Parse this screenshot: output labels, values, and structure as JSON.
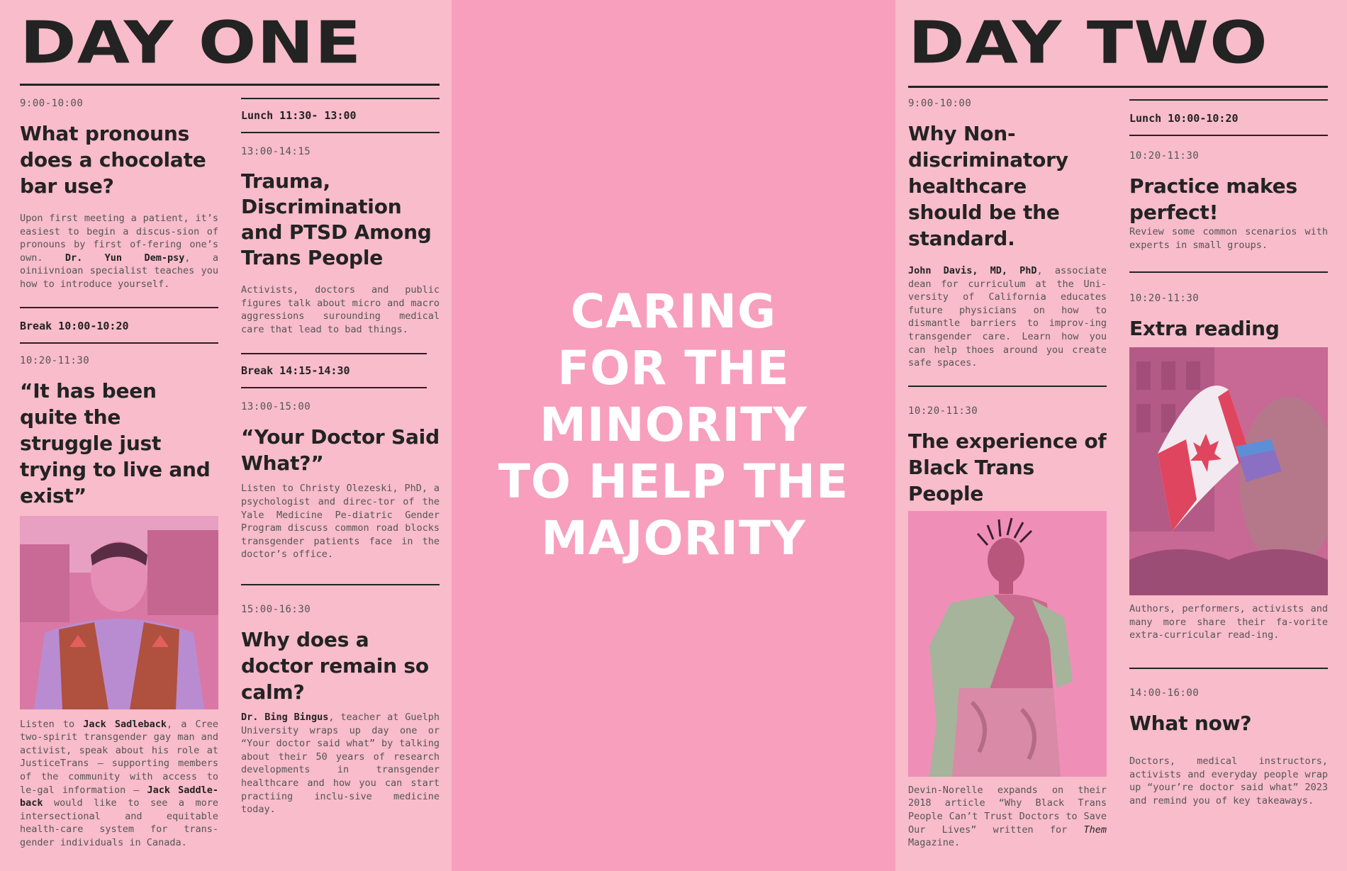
{
  "day_one": {
    "title": "Day One",
    "s1_time": "9:00-10:00",
    "s1_title": "What pronouns does a chocolate bar use?",
    "s1_desc_a": "Upon first meeting a patient, it’s easiest to begin a discus-sion of pronouns by first of-fering one’s own. ",
    "s1_speaker": "Dr. Yun Dem-psy",
    "s1_desc_b": ", a oiniivnioan specialist teaches you how to introduce yourself.",
    "break1": "Break 10:00-10:20",
    "s2_time": "10:20-11:30",
    "s2_title": "“It has been quite the struggle just trying to live and exist”",
    "s2_desc_a": "Listen to ",
    "s2_speaker": "Jack Sadleback",
    "s2_desc_b": ", a Cree two-spirit transgender gay man and activist, speak about his role at JusticeTrans – supporting members of the community with access to le-gal information – ",
    "s2_speaker2": "Jack Saddle-back",
    "s2_desc_c": " would like to see a more intersectional and equitable health-care system for trans-gender individuals in Canada.",
    "lunch": "Lunch 11:30- 13:00",
    "s3_time": "13:00-14:15",
    "s3_title": "Trauma, Discrimination and PTSD Among Trans People",
    "s3_desc": "Activists, doctors and public figures talk about micro and macro aggressions surounding medical care that lead to bad things.",
    "break2": "Break 14:15-14:30",
    "s4_time": "13:00-15:00",
    "s4_title": "“Your Doctor Said What?”",
    "s4_desc": "Listen to Christy Olezeski, PhD, a psychologist and direc-tor of the Yale Medicine Pe-diatric Gender Program discuss common road blocks transgender patients face in the doctor’s office.",
    "s5_time": "15:00-16:30",
    "s5_title": "Why does a doctor remain so calm?",
    "s5_speaker": "Dr. Bing Bingus",
    "s5_desc": ", teacher at Guelph University wraps up day one or “Your doctor said what” by talking about their 50 years of research developments in transgender healthcare and how you can start practiing inclu-sive medicine today."
  },
  "center": {
    "line1": "Caring",
    "line2": "for the",
    "line3": "minority",
    "line4": "to help the",
    "line5": "majority"
  },
  "day_two": {
    "title": "Day Two",
    "s1_time": "9:00-10:00",
    "s1_title": "Why Non-discriminatory healthcare should be the standard.",
    "s1_speaker": "John Davis, MD, PhD",
    "s1_desc": ", associate dean for curriculum at the Uni-versity of California educates future physicians on how to dismantle barriers to improv-ing transgender care. Learn how you can help thoes around you create safe spaces.",
    "s2_time": "10:20-11:30",
    "s2_title": "The experience of Black Trans People",
    "s2_desc_a": "Devin-Norelle expands on their 2018 article “Why Black Trans People Can’t Trust Doctors to Save Our Lives” written for ",
    "s2_mag": "Them",
    "s2_desc_b": " Magazine.",
    "lunch": "Lunch 10:00-10:20",
    "s3_time": "10:20-11:30",
    "s3_title": "Practice makes perfect!",
    "s3_desc": "Review some common scenarios with experts in small groups.",
    "s4_time": "10:20-11:30",
    "s4_title": "Extra reading",
    "s4_desc": "Authors, performers, activists and many more share their fa-vorite extra-curricular read-ing.",
    "s5_time": "14:00-16:00",
    "s5_title": "What now?",
    "s5_desc": "Doctors, medical instructors, activists and everyday people wrap up “your’re doctor said what” 2023 and remind you of key takeaways."
  },
  "colors": {
    "side_panel": "#f8bccb",
    "center_panel": "#f79fbd",
    "ink": "#232323",
    "photo_tint": "#e0609a"
  }
}
